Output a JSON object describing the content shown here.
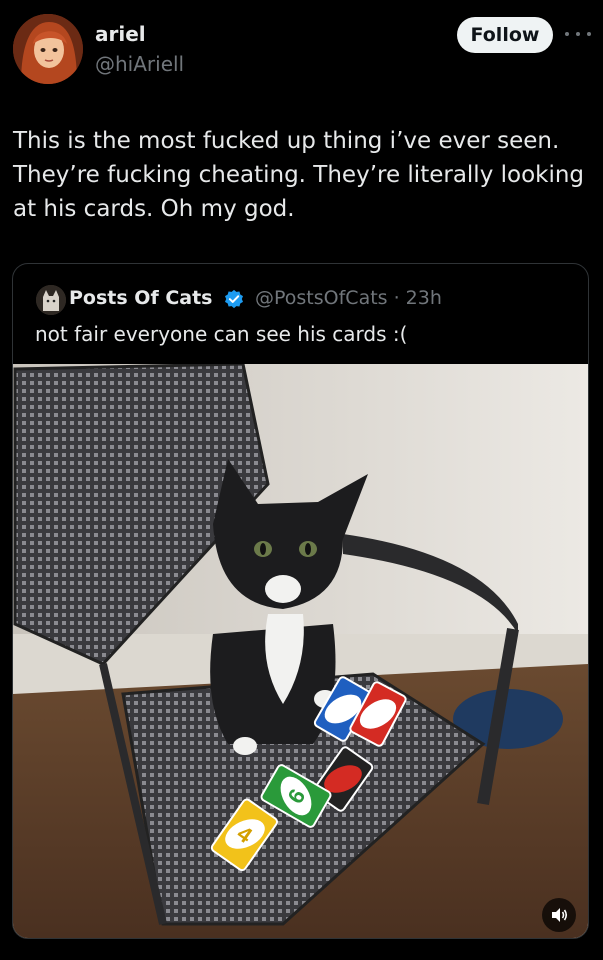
{
  "author": {
    "name": "ariel",
    "handle": "@hiAriell"
  },
  "actions": {
    "follow_label": "Follow"
  },
  "tweet": {
    "text": "This is the most fucked up thing i’ve ever seen.\nThey’re fucking cheating. They’re literally looking\nat his cards. Oh my god."
  },
  "quoted": {
    "name": "Posts Of Cats",
    "handle": "@PostsOfCats · 23h",
    "text": "not fair everyone can see his cards :(",
    "verified_color": "#1d9bf0"
  },
  "media": {
    "cards": {
      "yellow": "4",
      "green": "6"
    }
  },
  "icons": [
    "more-icon",
    "verified-icon",
    "volume-icon"
  ],
  "colors": {
    "background": "#000000",
    "text": "#e7e9ea",
    "muted": "#71767b",
    "follow_bg": "#eff3f4"
  }
}
